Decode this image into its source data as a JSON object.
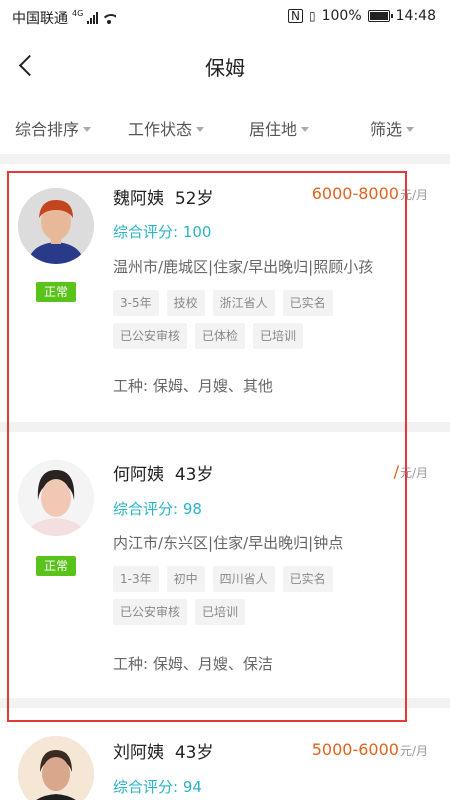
{
  "status_bar": {
    "carrier": "中国联通",
    "network": "4G",
    "battery": "100%",
    "time": "14:48"
  },
  "header": {
    "title": "保姆"
  },
  "filters": [
    {
      "label": "综合排序"
    },
    {
      "label": "工作状态"
    },
    {
      "label": "居住地"
    },
    {
      "label": "筛选"
    }
  ],
  "workers": [
    {
      "name": "魏阿姨",
      "age": "52岁",
      "price": "6000-8000",
      "unit": "元/月",
      "score_label": "综合评分:",
      "score": "100",
      "location": "温州市/鹿城区|住家/早出晚归|照顾小孩",
      "status": "正常",
      "tags": [
        "3-5年",
        "技校",
        "浙江省人",
        "已实名",
        "已公安审核",
        "已体检",
        "已培训"
      ],
      "work_types": "工种: 保姆、月嫂、其他"
    },
    {
      "name": "何阿姨",
      "age": "43岁",
      "price": "/",
      "unit": "元/月",
      "score_label": "综合评分:",
      "score": "98",
      "location": "内江市/东兴区|住家/早出晚归|钟点",
      "status": "正常",
      "tags": [
        "1-3年",
        "初中",
        "四川省人",
        "已实名",
        "已公安审核",
        "已培训"
      ],
      "work_types": "工种: 保姆、月嫂、保洁"
    },
    {
      "name": "刘阿姨",
      "age": "43岁",
      "price": "5000-6000",
      "unit": "元/月",
      "score_label": "综合评分:",
      "score": "94"
    }
  ],
  "colors": {
    "price": "#e0631e",
    "score": "#2bb3c7",
    "status_badge": "#5ac31b",
    "highlight_border": "#e53935"
  }
}
